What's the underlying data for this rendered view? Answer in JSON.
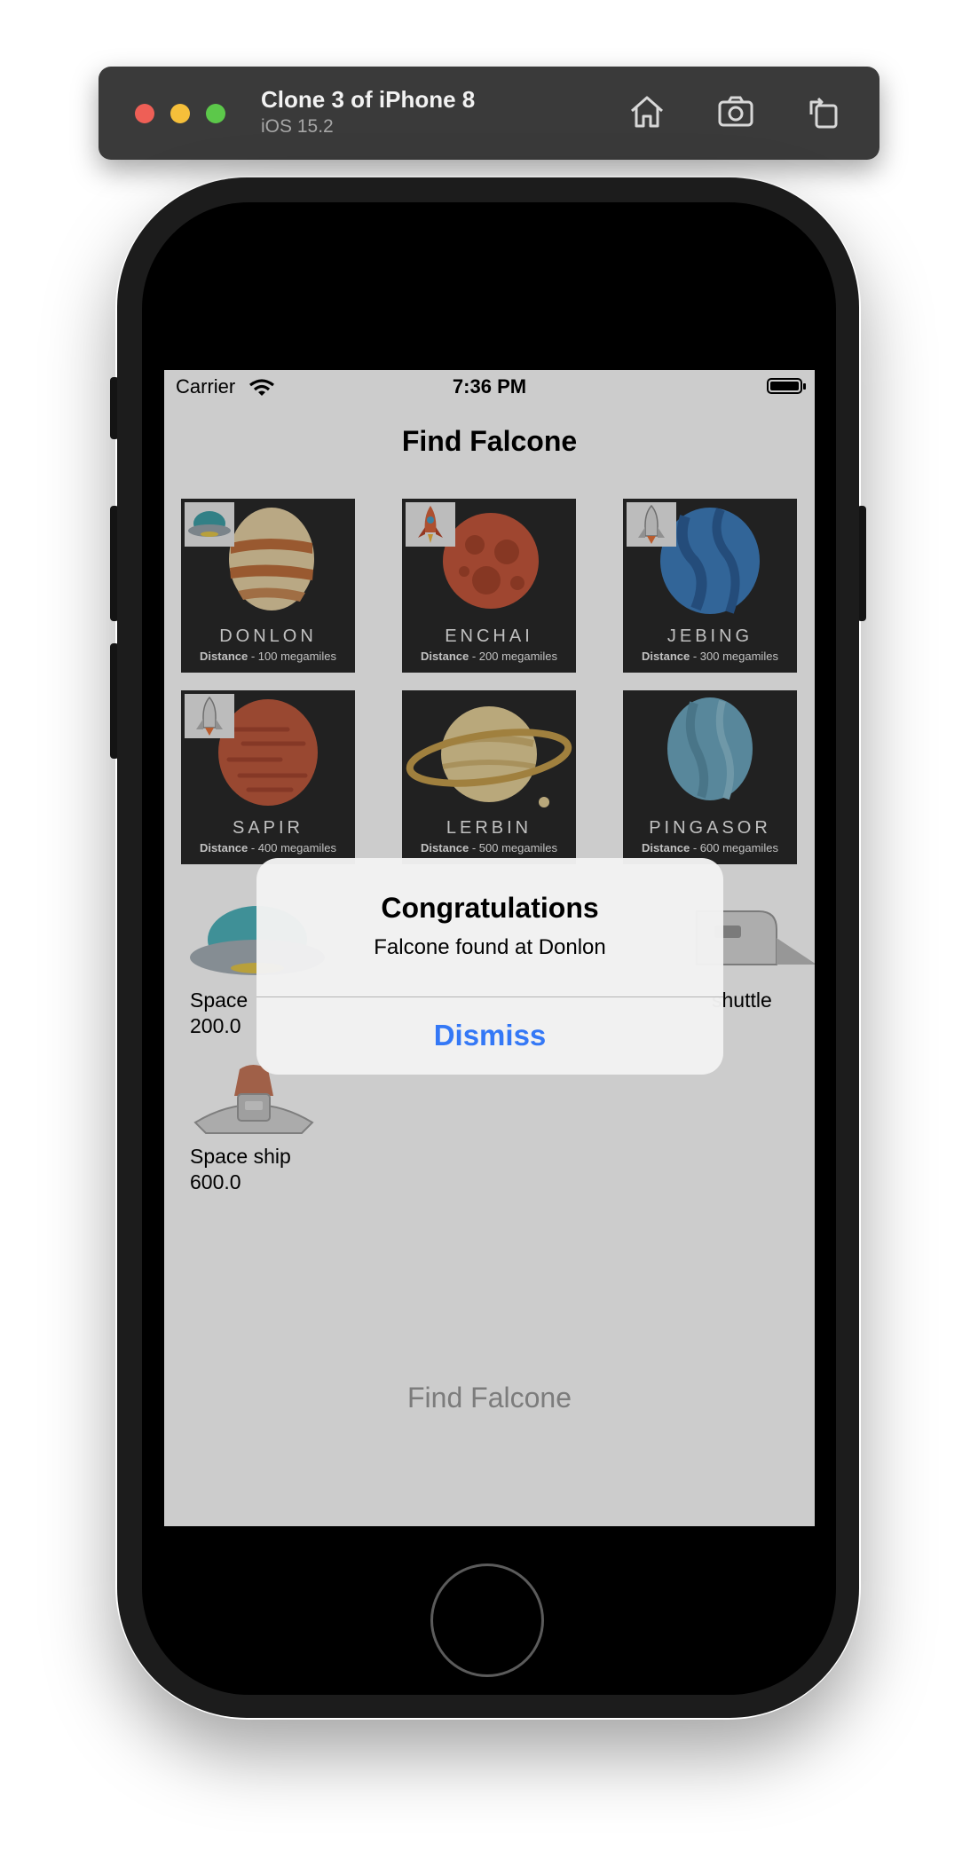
{
  "simulator": {
    "device_name": "Clone 3 of iPhone 8",
    "os_version": "iOS 15.2",
    "toolbar": [
      "home-icon",
      "screenshot-icon",
      "rotate-icon"
    ]
  },
  "status_bar": {
    "carrier": "Carrier",
    "time": "7:36 PM"
  },
  "nav": {
    "title": "Find Falcone"
  },
  "planets": [
    {
      "name": "DONLON",
      "distance_label": "Distance",
      "distance_value": " - 100 megamiles",
      "vehicle_badge": "space-pod-icon",
      "color": "#e0c9a0"
    },
    {
      "name": "ENCHAI",
      "distance_label": "Distance",
      "distance_value": " - 200 megamiles",
      "vehicle_badge": "space-rocket-icon",
      "color": "#c7583c"
    },
    {
      "name": "JEBING",
      "distance_label": "Distance",
      "distance_value": " - 300 megamiles",
      "vehicle_badge": "space-shuttle-icon",
      "color": "#3f7fbf"
    },
    {
      "name": "SAPIR",
      "distance_label": "Distance",
      "distance_value": " - 400 megamiles",
      "vehicle_badge": "space-shuttle-icon",
      "color": "#c05a3e"
    },
    {
      "name": "LERBIN",
      "distance_label": "Distance",
      "distance_value": " - 500 megamiles",
      "vehicle_badge": null,
      "color": "#e8d29a"
    },
    {
      "name": "PINGASOR",
      "distance_label": "Distance",
      "distance_value": " - 600 megamiles",
      "vehicle_badge": null,
      "color": "#6fa9c2"
    }
  ],
  "vehicles": [
    {
      "name": "Space",
      "value": "200.0",
      "icon": "space-pod-icon"
    },
    {
      "name": "shuttle",
      "value": "",
      "icon": "space-shuttle-icon"
    },
    {
      "name": "Space ship",
      "value": "600.0",
      "icon": "space-ship-icon"
    }
  ],
  "find_button": {
    "label": "Find Falcone"
  },
  "alert": {
    "title": "Congratulations",
    "message": "Falcone found at Donlon",
    "button": "Dismiss"
  },
  "colors": {
    "alert_button": "#3478f6",
    "disabled_button": "#9b9b9b"
  }
}
